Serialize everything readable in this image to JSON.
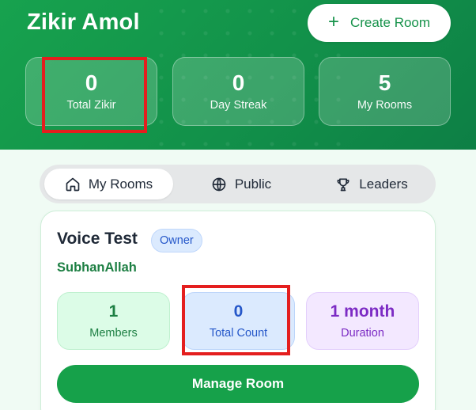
{
  "app": {
    "title": "Zikir Amol"
  },
  "header": {
    "create_room_label": "Create Room",
    "create_room_icon": "plus-icon"
  },
  "stats": [
    {
      "value": "0",
      "label": "Total Zikir"
    },
    {
      "value": "0",
      "label": "Day Streak"
    },
    {
      "value": "5",
      "label": "My Rooms"
    }
  ],
  "tabs": [
    {
      "label": "My Rooms",
      "icon": "home-icon",
      "active": true
    },
    {
      "label": "Public",
      "icon": "globe-icon",
      "active": false
    },
    {
      "label": "Leaders",
      "icon": "trophy-icon",
      "active": false
    }
  ],
  "room": {
    "name": "Voice Test",
    "role_badge": "Owner",
    "zikr": "SubhanAllah",
    "metrics": [
      {
        "value": "1",
        "label": "Members"
      },
      {
        "value": "0",
        "label": "Total Count"
      },
      {
        "value": "1 month",
        "label": "Duration"
      }
    ],
    "manage_label": "Manage Room"
  },
  "colors": {
    "brand_green": "#16a14a",
    "highlight_red": "#e41e1e",
    "badge_blue": "#2557c9",
    "duration_purple": "#7c2bc4"
  }
}
